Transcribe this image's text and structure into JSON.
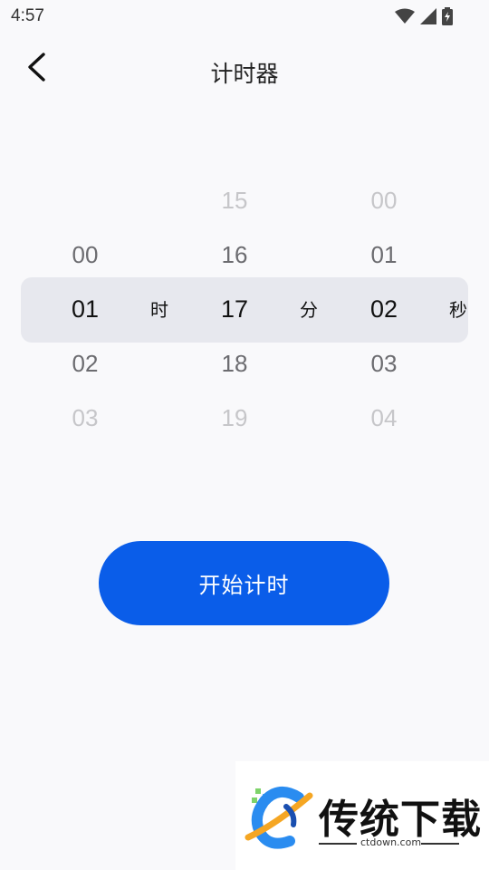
{
  "status_bar": {
    "time": "4:57",
    "icons": [
      "wifi-icon",
      "signal-icon",
      "battery-charging-icon"
    ]
  },
  "header": {
    "back_icon": "chevron-left-icon",
    "title": "计时器"
  },
  "picker": {
    "hours": {
      "values": [
        "00",
        "01",
        "02",
        "03"
      ],
      "selected": "01",
      "unit": "时"
    },
    "minutes": {
      "values": [
        "15",
        "16",
        "17",
        "18",
        "19"
      ],
      "selected": "17",
      "unit": "分"
    },
    "seconds": {
      "values": [
        "00",
        "01",
        "02",
        "03",
        "04"
      ],
      "selected": "02",
      "unit": "秒"
    }
  },
  "start_button": {
    "label": "开始计时"
  },
  "watermark": {
    "brand": "传统下载",
    "url": "ctdown.com"
  },
  "colors": {
    "accent": "#0a5de9",
    "background": "#f9f9fb",
    "selection_band": "#e7e8ee"
  }
}
